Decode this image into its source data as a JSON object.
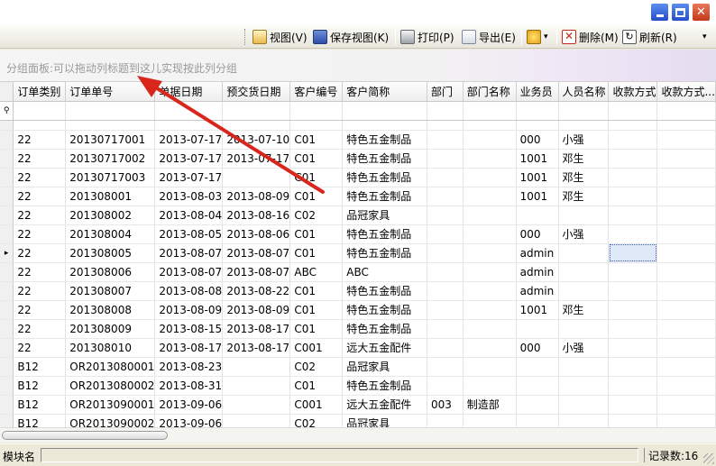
{
  "toolbar": {
    "view_label": "视图(V)",
    "save_view_label": "保存视图(K)",
    "print_label": "打印(P)",
    "export_label": "导出(E)",
    "delete_label": "删除(M)",
    "refresh_label": "刷新(R)"
  },
  "group_panel": {
    "hint": "分组面板:可以拖动列标题到这儿实现按此列分组"
  },
  "grid": {
    "columns": [
      "订单类别",
      "订单单号",
      "单据日期",
      "预交货日期",
      "客户编号",
      "客户简称",
      "部门",
      "部门名称",
      "业务员",
      "人员名称",
      "收款方式",
      "收款方式..."
    ],
    "current_row_index": 6,
    "rows": [
      [
        "22",
        "20130717001",
        "2013-07-17",
        "2013-07-10",
        "C01",
        "特色五金制品",
        "",
        "",
        "000",
        "小强",
        "",
        ""
      ],
      [
        "22",
        "20130717002",
        "2013-07-17",
        "2013-07-17",
        "C01",
        "特色五金制品",
        "",
        "",
        "1001",
        "邓生",
        "",
        ""
      ],
      [
        "22",
        "20130717003",
        "2013-07-17",
        "",
        "C01",
        "特色五金制品",
        "",
        "",
        "1001",
        "邓生",
        "",
        ""
      ],
      [
        "22",
        "201308001",
        "2013-08-03",
        "2013-08-09",
        "C01",
        "特色五金制品",
        "",
        "",
        "1001",
        "邓生",
        "",
        ""
      ],
      [
        "22",
        "201308002",
        "2013-08-04",
        "2013-08-16",
        "C02",
        "品冠家具",
        "",
        "",
        "",
        "",
        "",
        ""
      ],
      [
        "22",
        "201308004",
        "2013-08-05",
        "2013-08-06",
        "C01",
        "特色五金制品",
        "",
        "",
        "000",
        "小强",
        "",
        ""
      ],
      [
        "22",
        "201308005",
        "2013-08-07",
        "2013-08-07",
        "C01",
        "特色五金制品",
        "",
        "",
        "admin",
        "",
        "",
        ""
      ],
      [
        "22",
        "201308006",
        "2013-08-07",
        "2013-08-07",
        "ABC",
        "ABC",
        "",
        "",
        "admin",
        "",
        "",
        ""
      ],
      [
        "22",
        "201308007",
        "2013-08-08",
        "2013-08-22",
        "C01",
        "特色五金制品",
        "",
        "",
        "admin",
        "",
        "",
        ""
      ],
      [
        "22",
        "201308008",
        "2013-08-09",
        "2013-08-09",
        "C01",
        "特色五金制品",
        "",
        "",
        "1001",
        "邓生",
        "",
        ""
      ],
      [
        "22",
        "201308009",
        "2013-08-15",
        "2013-08-17",
        "C01",
        "特色五金制品",
        "",
        "",
        "",
        "",
        "",
        ""
      ],
      [
        "22",
        "201308010",
        "2013-08-17",
        "2013-08-17",
        "C001",
        "远大五金配件",
        "",
        "",
        "000",
        "小强",
        "",
        ""
      ],
      [
        "B12",
        "OR2013080001",
        "2013-08-23",
        "",
        "C02",
        "品冠家具",
        "",
        "",
        "",
        "",
        "",
        ""
      ],
      [
        "B12",
        "OR2013080002",
        "2013-08-31",
        "",
        "C01",
        "特色五金制品",
        "",
        "",
        "",
        "",
        "",
        ""
      ],
      [
        "B12",
        "OR2013090001",
        "2013-09-06",
        "",
        "C001",
        "远大五金配件",
        "003",
        "制造部",
        "",
        "",
        "",
        ""
      ],
      [
        "B12",
        "OR2013090002",
        "2013-09-06",
        "",
        "C02",
        "品冠家具",
        "",
        "",
        "",
        "",
        "",
        ""
      ]
    ]
  },
  "status": {
    "module_label": "模块名",
    "record_count": "记录数:16"
  },
  "annotation": {
    "arrow_color": "#d9261c"
  }
}
